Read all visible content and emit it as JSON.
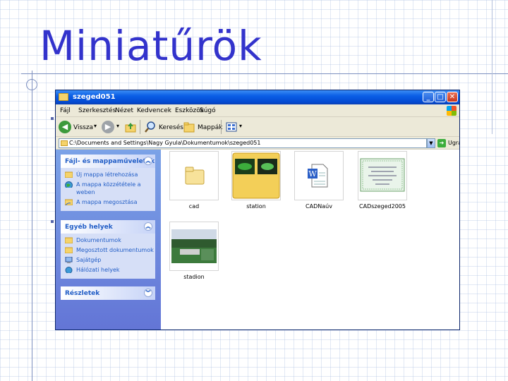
{
  "slide": {
    "title": "Miniatűrök"
  },
  "window": {
    "title": "szeged051",
    "controls": {
      "minimize": "_",
      "maximize": "□",
      "close": "✕"
    },
    "menu": [
      "Fájl",
      "Szerkesztés",
      "Nézet",
      "Kedvencek",
      "Eszközök",
      "Súgó"
    ],
    "toolbar": {
      "back_label": "Vissza",
      "search_label": "Keresés",
      "folders_label": "Mappák"
    },
    "address": {
      "path": "C:\\Documents and Settings\\Nagy Gyula\\Dokumentumok\\szeged051",
      "go_label": "Ugrás"
    }
  },
  "taskpane": {
    "file_tasks": {
      "title": "Fájl- és mappaműveletek",
      "links": [
        "Új mappa létrehozása",
        "A mappa közzététele a weben",
        "A mappa megosztása"
      ]
    },
    "other_places": {
      "title": "Egyéb helyek",
      "links": [
        "Dokumentumok",
        "Megosztott dokumentumok",
        "Sajátgép",
        "Hálózati helyek"
      ]
    },
    "details": {
      "title": "Részletek"
    }
  },
  "files": [
    {
      "name": "cad",
      "kind": "folder"
    },
    {
      "name": "station",
      "kind": "folder-with-preview"
    },
    {
      "name": "CADNaúv",
      "kind": "word-document"
    },
    {
      "name": "CADszeged2005",
      "kind": "image"
    },
    {
      "name": "stadion",
      "kind": "image"
    }
  ],
  "colors": {
    "slide_title": "#3333cc",
    "titlebar": "#0a5ee6",
    "taskpane": "#7ba2e7",
    "link": "#215dc6"
  }
}
